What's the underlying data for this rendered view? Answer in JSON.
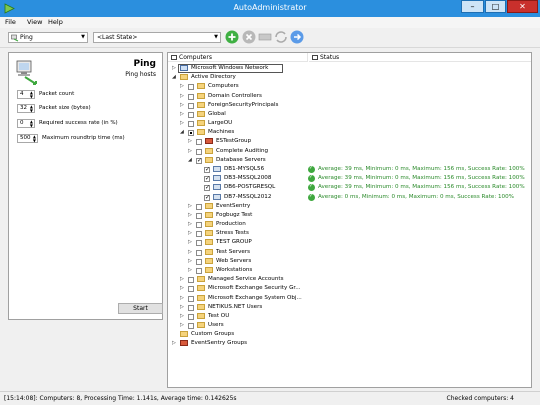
{
  "window": {
    "title": "AutoAdministrator",
    "minimize": "–",
    "maximize": "□",
    "close": "✕"
  },
  "menu": [
    "File",
    "View",
    "Help"
  ],
  "toolbar": {
    "action_select": "Ping",
    "state_select": "<Last State>",
    "icons": [
      "add-icon",
      "remove-icon",
      "properties-icon",
      "run-icon",
      "go-icon"
    ]
  },
  "ping_panel": {
    "title": "Ping",
    "subtitle": "Ping hosts",
    "params": [
      {
        "value": "4",
        "label": "Packet count"
      },
      {
        "value": "32",
        "label": "Packet size (bytes)"
      },
      {
        "value": "0",
        "label": "Required success rate (in %)"
      },
      {
        "value": "500",
        "label": "Maximum roundtrip time (ms)"
      }
    ],
    "start_label": "Start"
  },
  "tree": {
    "col_computers": "Computers",
    "col_status": "Status",
    "nodes": [
      {
        "label": "Microsoft Windows Network",
        "level": 0,
        "expander": "▷",
        "icon": "network",
        "checkbox": "none"
      },
      {
        "label": "Active Directory",
        "level": 0,
        "expander": "◢",
        "icon": "folder",
        "checkbox": "none"
      },
      {
        "label": "Computers",
        "level": 1,
        "expander": "▷",
        "icon": "folder",
        "checkbox": "empty"
      },
      {
        "label": "Domain Controllers",
        "level": 1,
        "expander": "▷",
        "icon": "folder",
        "checkbox": "empty"
      },
      {
        "label": "ForeignSecurityPrincipals",
        "level": 1,
        "expander": "▷",
        "icon": "folder",
        "checkbox": "empty"
      },
      {
        "label": "Global",
        "level": 1,
        "expander": "▷",
        "icon": "folder",
        "checkbox": "empty"
      },
      {
        "label": "LargeOU",
        "level": 1,
        "expander": "▷",
        "icon": "folder",
        "checkbox": "empty"
      },
      {
        "label": "Machines",
        "level": 1,
        "expander": "◢",
        "icon": "folder",
        "checkbox": "partial"
      },
      {
        "label": "ESTestGroup",
        "level": 2,
        "expander": "▷",
        "icon": "group",
        "checkbox": "empty"
      },
      {
        "label": "Complete Auditing",
        "level": 2,
        "expander": "▷",
        "icon": "folder",
        "checkbox": "empty"
      },
      {
        "label": "Database Servers",
        "level": 2,
        "expander": "◢",
        "icon": "folder",
        "checkbox": "checked"
      },
      {
        "label": "DB1-MYSQL56",
        "level": 3,
        "expander": "",
        "icon": "server",
        "checkbox": "checked",
        "status": "Average: 39 ms, Minimum: 0 ms, Maximum: 156 ms, Success Rate: 100%"
      },
      {
        "label": "DB3-MSSQL2008",
        "level": 3,
        "expander": "",
        "icon": "server",
        "checkbox": "checked",
        "status": "Average: 39 ms, Minimum: 0 ms, Maximum: 156 ms, Success Rate: 100%"
      },
      {
        "label": "DB6-POSTGRESQL",
        "level": 3,
        "expander": "",
        "icon": "server",
        "checkbox": "checked",
        "status": "Average: 39 ms, Minimum: 0 ms, Maximum: 156 ms, Success Rate: 100%"
      },
      {
        "label": "DB7-MSSQL2012",
        "level": 3,
        "expander": "",
        "icon": "server",
        "checkbox": "checked",
        "status": "Average: 0 ms, Minimum: 0 ms, Maximum: 0 ms, Success Rate: 100%"
      },
      {
        "label": "EventSentry",
        "level": 2,
        "expander": "▷",
        "icon": "folder",
        "checkbox": "empty"
      },
      {
        "label": "Fogbugz Test",
        "level": 2,
        "expander": "▷",
        "icon": "folder",
        "checkbox": "empty"
      },
      {
        "label": "Production",
        "level": 2,
        "expander": "▷",
        "icon": "folder",
        "checkbox": "empty"
      },
      {
        "label": "Stress Tests",
        "level": 2,
        "expander": "▷",
        "icon": "folder",
        "checkbox": "empty"
      },
      {
        "label": "TEST GROUP",
        "level": 2,
        "expander": "▷",
        "icon": "folder",
        "checkbox": "empty"
      },
      {
        "label": "Test Servers",
        "level": 2,
        "expander": "▷",
        "icon": "folder",
        "checkbox": "empty"
      },
      {
        "label": "Web Servers",
        "level": 2,
        "expander": "▷",
        "icon": "folder",
        "checkbox": "empty"
      },
      {
        "label": "Workstations",
        "level": 2,
        "expander": "▷",
        "icon": "folder",
        "checkbox": "empty"
      },
      {
        "label": "Managed Service Accounts",
        "level": 1,
        "expander": "▷",
        "icon": "folder",
        "checkbox": "empty"
      },
      {
        "label": "Microsoft Exchange Security Gr...",
        "level": 1,
        "expander": "▷",
        "icon": "folder",
        "checkbox": "empty"
      },
      {
        "label": "Microsoft Exchange System Obj...",
        "level": 1,
        "expander": "▷",
        "icon": "folder",
        "checkbox": "empty"
      },
      {
        "label": "NETIKUS.NET Users",
        "level": 1,
        "expander": "▷",
        "icon": "folder",
        "checkbox": "empty"
      },
      {
        "label": "Test OU",
        "level": 1,
        "expander": "▷",
        "icon": "folder",
        "checkbox": "empty"
      },
      {
        "label": "Users",
        "level": 1,
        "expander": "▷",
        "icon": "folder",
        "checkbox": "empty"
      },
      {
        "label": "Custom Groups",
        "level": 0,
        "expander": "",
        "icon": "folder",
        "checkbox": "none"
      },
      {
        "label": "EventSentry Groups",
        "level": 0,
        "expander": "▷",
        "icon": "group",
        "checkbox": "none"
      }
    ]
  },
  "statusbar": {
    "left": "[15:14:08]: Computers: 8, Processing Time: 1.141s, Average time: 0.142625s",
    "right": "Checked computers: 4"
  },
  "colors": {
    "titlebar": "#2b8fde",
    "ok": "#3fa83f",
    "status_text": "#2a8a2a"
  }
}
